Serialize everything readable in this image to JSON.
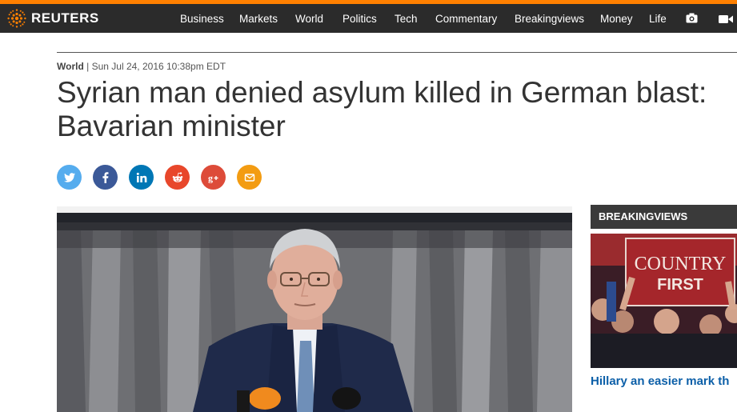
{
  "brand": {
    "name": "REUTERS",
    "accent": "#ff8000"
  },
  "nav": {
    "items": [
      {
        "label": "Business"
      },
      {
        "label": "Markets"
      },
      {
        "label": "World"
      },
      {
        "label": "Politics"
      },
      {
        "label": "Tech"
      },
      {
        "label": "Commentary"
      },
      {
        "label": "Breakingviews"
      },
      {
        "label": "Money"
      },
      {
        "label": "Life"
      }
    ],
    "icons": [
      "camera-icon",
      "video-icon"
    ]
  },
  "article": {
    "section": "World",
    "separator": "|",
    "date": "Sun Jul 24, 2016 10:38pm EDT",
    "headline_line1": "Syrian man denied asylum killed in German blast:",
    "headline_line2": "Bavarian minister"
  },
  "share": [
    {
      "name": "twitter",
      "icon": "twitter-icon",
      "color": "#55acee"
    },
    {
      "name": "facebook",
      "icon": "facebook-icon",
      "color": "#3b5998"
    },
    {
      "name": "linkedin",
      "icon": "linkedin-icon",
      "color": "#0077b5"
    },
    {
      "name": "reddit",
      "icon": "reddit-icon",
      "color": "#e8472b"
    },
    {
      "name": "googleplus",
      "icon": "google-plus-icon",
      "color": "#dd4b39"
    },
    {
      "name": "email",
      "icon": "email-icon",
      "color": "#f39c12"
    }
  ],
  "sidebar": {
    "heading": "BREAKINGVIEWS",
    "sign_line1": "COUNTRY",
    "sign_line2": "FIRST",
    "headline": "Hillary an easier mark th"
  }
}
